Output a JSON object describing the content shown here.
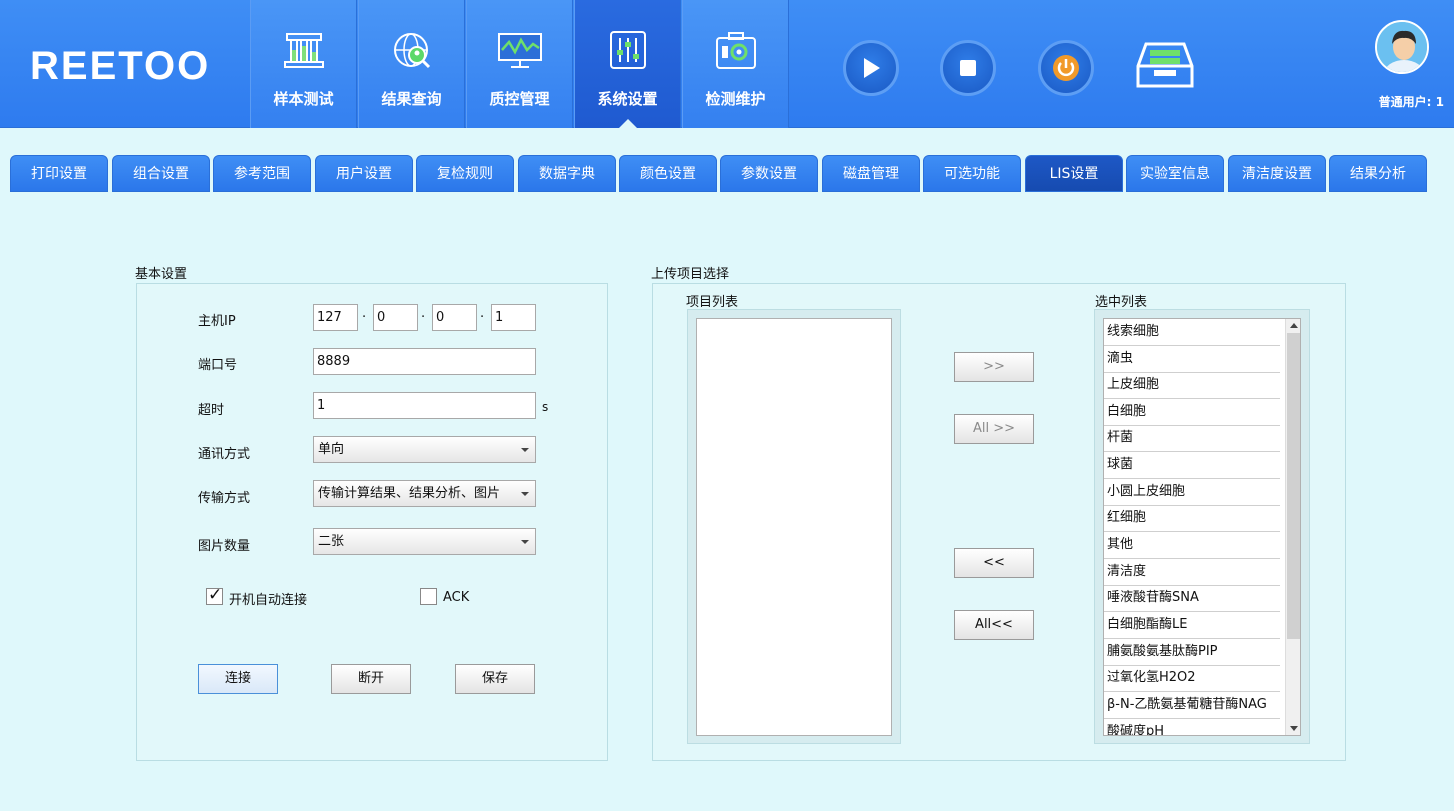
{
  "brand": "REETOO",
  "nav": [
    {
      "label": "样本测试",
      "icon": "test-tubes-icon"
    },
    {
      "label": "结果查询",
      "icon": "globe-search-icon"
    },
    {
      "label": "质控管理",
      "icon": "monitor-chart-icon"
    },
    {
      "label": "系统设置",
      "icon": "sliders-icon",
      "active": true
    },
    {
      "label": "检测维护",
      "icon": "toolbox-gear-icon"
    }
  ],
  "controls": [
    "play-icon",
    "stop-icon",
    "power-icon",
    "tray-icon"
  ],
  "user": {
    "label": "普通用户: 1"
  },
  "tabs": [
    {
      "label": "打印设置"
    },
    {
      "label": "组合设置"
    },
    {
      "label": "参考范围"
    },
    {
      "label": "用户设置"
    },
    {
      "label": "复检规则"
    },
    {
      "label": "数据字典"
    },
    {
      "label": "颜色设置"
    },
    {
      "label": "参数设置"
    },
    {
      "label": "磁盘管理"
    },
    {
      "label": "可选功能"
    },
    {
      "label": "LIS设置",
      "active": true
    },
    {
      "label": "实验室信息"
    },
    {
      "label": "清洁度设置"
    },
    {
      "label": "结果分析"
    }
  ],
  "basic": {
    "title": "基本设置",
    "host_ip_label": "主机IP",
    "ip": [
      "127",
      "0",
      "0",
      "1"
    ],
    "ip_sep": "·",
    "port_label": "端口号",
    "port": "8889",
    "timeout_label": "超时",
    "timeout": "1",
    "timeout_unit": "s",
    "comm_label": "通讯方式",
    "comm_value": "单向",
    "transfer_label": "传输方式",
    "transfer_value": "传输计算结果、结果分析、图片",
    "pictures_label": "图片数量",
    "pictures_value": "二张",
    "autoconnect_label": "开机自动连接",
    "autoconnect_checked": true,
    "ack_label": "ACK",
    "ack_checked": false,
    "connect_label": "连接",
    "disconnect_label": "断开",
    "save_label": "保存"
  },
  "upload": {
    "title": "上传项目选择",
    "project_list_label": "项目列表",
    "selected_list_label": "选中列表",
    "add_label": ">>",
    "add_all_label": "All >>",
    "remove_label": "<<",
    "remove_all_label": "All<<",
    "project_items": [],
    "selected_items": [
      "线索细胞",
      "滴虫",
      "上皮细胞",
      "白细胞",
      "杆菌",
      "球菌",
      "小圆上皮细胞",
      "红细胞",
      "其他",
      "清洁度",
      "唾液酸苷酶SNA",
      "白细胞酯酶LE",
      "脯氨酸氨基肽酶PIP",
      "过氧化氢H2O2",
      "β-N-乙酰氨基葡糖苷酶NAG",
      "酸碱度pH"
    ]
  },
  "colors": {
    "topbar": "#3a88f3",
    "active_nav": "#1f5ad0",
    "background": "#dff8fb"
  }
}
